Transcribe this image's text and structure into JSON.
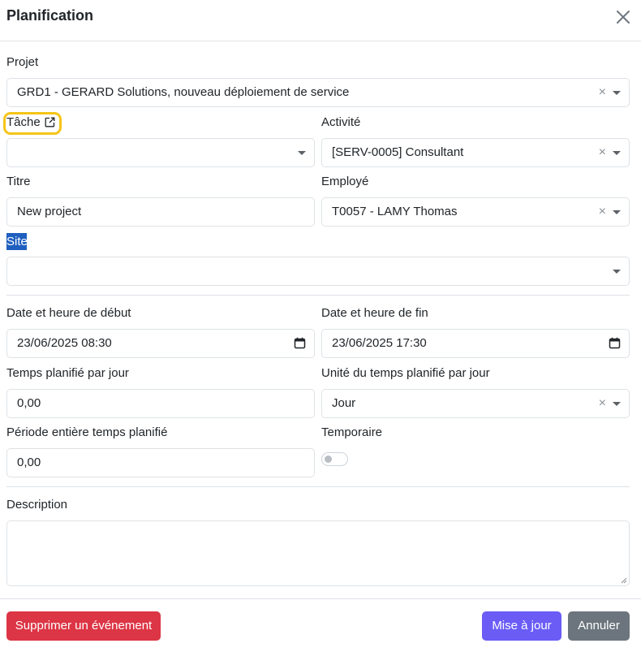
{
  "modal": {
    "title": "Planification"
  },
  "fields": {
    "projet": {
      "label": "Projet",
      "value": "GRD1 - GERARD Solutions, nouveau déploiement de service",
      "clear": "×"
    },
    "tache": {
      "label": "Tâche",
      "value": ""
    },
    "activite": {
      "label": "Activité",
      "value": "[SERV-0005] Consultant",
      "clear": "×"
    },
    "titre": {
      "label": "Titre",
      "value": "New project"
    },
    "employe": {
      "label": "Employé",
      "value": "T0057 - LAMY Thomas",
      "clear": "×"
    },
    "site": {
      "label": "Site",
      "value": ""
    },
    "date_debut": {
      "label": "Date et heure de début",
      "value": "23/06/2025 08:30"
    },
    "date_fin": {
      "label": "Date et heure de fin",
      "value": "23/06/2025 17:30"
    },
    "temps_jour": {
      "label": "Temps planifié par jour",
      "value": "0,00"
    },
    "unite": {
      "label": "Unité du temps planifié par jour",
      "value": "Jour",
      "clear": "×"
    },
    "periode": {
      "label": "Période entière temps planifié",
      "value": "0,00"
    },
    "temporaire": {
      "label": "Temporaire",
      "checked": false
    },
    "description": {
      "label": "Description",
      "value": ""
    }
  },
  "buttons": {
    "delete": "Supprimer un événement",
    "update": "Mise à jour",
    "cancel": "Annuler"
  },
  "colors": {
    "danger": "#dc3545",
    "primary": "#6a5cf5",
    "secondary": "#6c757d",
    "highlight": "#f5c518",
    "selection": "#1f5fbf"
  },
  "icons": {
    "close": "close-icon",
    "external_link": "external-link-icon",
    "calendar": "calendar-icon",
    "dropdown": "chevron-down-icon"
  }
}
